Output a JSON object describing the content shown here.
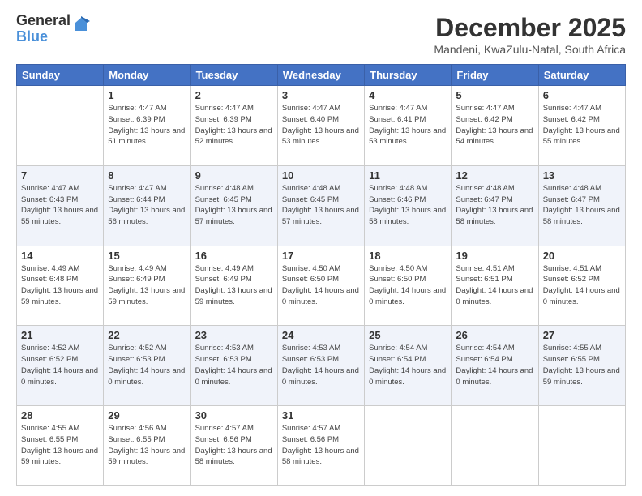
{
  "logo": {
    "general": "General",
    "blue": "Blue"
  },
  "title": "December 2025",
  "location": "Mandeni, KwaZulu-Natal, South Africa",
  "headers": [
    "Sunday",
    "Monday",
    "Tuesday",
    "Wednesday",
    "Thursday",
    "Friday",
    "Saturday"
  ],
  "weeks": [
    [
      {
        "num": "",
        "sunrise": "",
        "sunset": "",
        "daylight": ""
      },
      {
        "num": "1",
        "sunrise": "Sunrise: 4:47 AM",
        "sunset": "Sunset: 6:39 PM",
        "daylight": "Daylight: 13 hours and 51 minutes."
      },
      {
        "num": "2",
        "sunrise": "Sunrise: 4:47 AM",
        "sunset": "Sunset: 6:39 PM",
        "daylight": "Daylight: 13 hours and 52 minutes."
      },
      {
        "num": "3",
        "sunrise": "Sunrise: 4:47 AM",
        "sunset": "Sunset: 6:40 PM",
        "daylight": "Daylight: 13 hours and 53 minutes."
      },
      {
        "num": "4",
        "sunrise": "Sunrise: 4:47 AM",
        "sunset": "Sunset: 6:41 PM",
        "daylight": "Daylight: 13 hours and 53 minutes."
      },
      {
        "num": "5",
        "sunrise": "Sunrise: 4:47 AM",
        "sunset": "Sunset: 6:42 PM",
        "daylight": "Daylight: 13 hours and 54 minutes."
      },
      {
        "num": "6",
        "sunrise": "Sunrise: 4:47 AM",
        "sunset": "Sunset: 6:42 PM",
        "daylight": "Daylight: 13 hours and 55 minutes."
      }
    ],
    [
      {
        "num": "7",
        "sunrise": "Sunrise: 4:47 AM",
        "sunset": "Sunset: 6:43 PM",
        "daylight": "Daylight: 13 hours and 55 minutes."
      },
      {
        "num": "8",
        "sunrise": "Sunrise: 4:47 AM",
        "sunset": "Sunset: 6:44 PM",
        "daylight": "Daylight: 13 hours and 56 minutes."
      },
      {
        "num": "9",
        "sunrise": "Sunrise: 4:48 AM",
        "sunset": "Sunset: 6:45 PM",
        "daylight": "Daylight: 13 hours and 57 minutes."
      },
      {
        "num": "10",
        "sunrise": "Sunrise: 4:48 AM",
        "sunset": "Sunset: 6:45 PM",
        "daylight": "Daylight: 13 hours and 57 minutes."
      },
      {
        "num": "11",
        "sunrise": "Sunrise: 4:48 AM",
        "sunset": "Sunset: 6:46 PM",
        "daylight": "Daylight: 13 hours and 58 minutes."
      },
      {
        "num": "12",
        "sunrise": "Sunrise: 4:48 AM",
        "sunset": "Sunset: 6:47 PM",
        "daylight": "Daylight: 13 hours and 58 minutes."
      },
      {
        "num": "13",
        "sunrise": "Sunrise: 4:48 AM",
        "sunset": "Sunset: 6:47 PM",
        "daylight": "Daylight: 13 hours and 58 minutes."
      }
    ],
    [
      {
        "num": "14",
        "sunrise": "Sunrise: 4:49 AM",
        "sunset": "Sunset: 6:48 PM",
        "daylight": "Daylight: 13 hours and 59 minutes."
      },
      {
        "num": "15",
        "sunrise": "Sunrise: 4:49 AM",
        "sunset": "Sunset: 6:49 PM",
        "daylight": "Daylight: 13 hours and 59 minutes."
      },
      {
        "num": "16",
        "sunrise": "Sunrise: 4:49 AM",
        "sunset": "Sunset: 6:49 PM",
        "daylight": "Daylight: 13 hours and 59 minutes."
      },
      {
        "num": "17",
        "sunrise": "Sunrise: 4:50 AM",
        "sunset": "Sunset: 6:50 PM",
        "daylight": "Daylight: 14 hours and 0 minutes."
      },
      {
        "num": "18",
        "sunrise": "Sunrise: 4:50 AM",
        "sunset": "Sunset: 6:50 PM",
        "daylight": "Daylight: 14 hours and 0 minutes."
      },
      {
        "num": "19",
        "sunrise": "Sunrise: 4:51 AM",
        "sunset": "Sunset: 6:51 PM",
        "daylight": "Daylight: 14 hours and 0 minutes."
      },
      {
        "num": "20",
        "sunrise": "Sunrise: 4:51 AM",
        "sunset": "Sunset: 6:52 PM",
        "daylight": "Daylight: 14 hours and 0 minutes."
      }
    ],
    [
      {
        "num": "21",
        "sunrise": "Sunrise: 4:52 AM",
        "sunset": "Sunset: 6:52 PM",
        "daylight": "Daylight: 14 hours and 0 minutes."
      },
      {
        "num": "22",
        "sunrise": "Sunrise: 4:52 AM",
        "sunset": "Sunset: 6:53 PM",
        "daylight": "Daylight: 14 hours and 0 minutes."
      },
      {
        "num": "23",
        "sunrise": "Sunrise: 4:53 AM",
        "sunset": "Sunset: 6:53 PM",
        "daylight": "Daylight: 14 hours and 0 minutes."
      },
      {
        "num": "24",
        "sunrise": "Sunrise: 4:53 AM",
        "sunset": "Sunset: 6:53 PM",
        "daylight": "Daylight: 14 hours and 0 minutes."
      },
      {
        "num": "25",
        "sunrise": "Sunrise: 4:54 AM",
        "sunset": "Sunset: 6:54 PM",
        "daylight": "Daylight: 14 hours and 0 minutes."
      },
      {
        "num": "26",
        "sunrise": "Sunrise: 4:54 AM",
        "sunset": "Sunset: 6:54 PM",
        "daylight": "Daylight: 14 hours and 0 minutes."
      },
      {
        "num": "27",
        "sunrise": "Sunrise: 4:55 AM",
        "sunset": "Sunset: 6:55 PM",
        "daylight": "Daylight: 13 hours and 59 minutes."
      }
    ],
    [
      {
        "num": "28",
        "sunrise": "Sunrise: 4:55 AM",
        "sunset": "Sunset: 6:55 PM",
        "daylight": "Daylight: 13 hours and 59 minutes."
      },
      {
        "num": "29",
        "sunrise": "Sunrise: 4:56 AM",
        "sunset": "Sunset: 6:55 PM",
        "daylight": "Daylight: 13 hours and 59 minutes."
      },
      {
        "num": "30",
        "sunrise": "Sunrise: 4:57 AM",
        "sunset": "Sunset: 6:56 PM",
        "daylight": "Daylight: 13 hours and 58 minutes."
      },
      {
        "num": "31",
        "sunrise": "Sunrise: 4:57 AM",
        "sunset": "Sunset: 6:56 PM",
        "daylight": "Daylight: 13 hours and 58 minutes."
      },
      {
        "num": "",
        "sunrise": "",
        "sunset": "",
        "daylight": ""
      },
      {
        "num": "",
        "sunrise": "",
        "sunset": "",
        "daylight": ""
      },
      {
        "num": "",
        "sunrise": "",
        "sunset": "",
        "daylight": ""
      }
    ]
  ]
}
